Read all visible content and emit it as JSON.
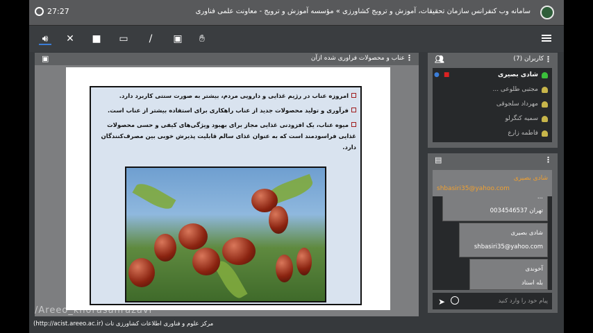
{
  "header": {
    "title": "سامانه وب کنفرانس سازمان تحقیقات، آموزش و ترویج کشاورزی » مؤسسه آموزش و ترویج - معاونت علمی فناوری",
    "time": "27:27"
  },
  "toolbar": {
    "icons": [
      "speaker-icon",
      "mic-off-icon",
      "camera-icon",
      "screen-share-icon",
      "brush-icon",
      "presentation-icon",
      "raise-hand-icon"
    ]
  },
  "presentation": {
    "title": "عناب و محصولات فراوری شده ازآن",
    "bullets": [
      "امروزه عناب در رژیم غذایی و دارویی مردم، بیشتر به صورت سنتی کاربرد دارد.",
      "فرآوری و تولید محصولات جدید از عناب راهکاری برای استفاده بیشتر از عناب است.",
      "میوه عناب، یک افزودنی غذایی مجاز برای بهبود ویژگی‌های کیفی و حسی محصولات غذایی فراسودمند است که به عنوان غذای سالم قابلیت پذیرش خوبی بین مصرف‌کنندگان دارد."
    ]
  },
  "watermark": "/Areeo_khorasanrazavi",
  "footer": "مرکز علوم و فناوری اطلاعات کشاورزی تات (http://acist.areeo.ac.ir)",
  "users": {
    "title": "کاربران (7)",
    "list": [
      "شادی بصیری",
      "مجتبی طلوعی ...",
      "مهرداد سلجوقی",
      "سمیه کنگرلو",
      "فاطمه زارع"
    ]
  },
  "chat": {
    "pinned_name": "شادی بصیری",
    "pinned_text": "shbasiri35@yahoo.com",
    "messages": [
      {
        "name": "...",
        "text": "تهران 0034546537"
      },
      {
        "name": "شادی بصیری",
        "text": "shbasiri35@yahoo.com"
      },
      {
        "name": "آخوندی",
        "text": "بله استاد"
      }
    ],
    "placeholder": "پیام خود را وارد کنید"
  }
}
